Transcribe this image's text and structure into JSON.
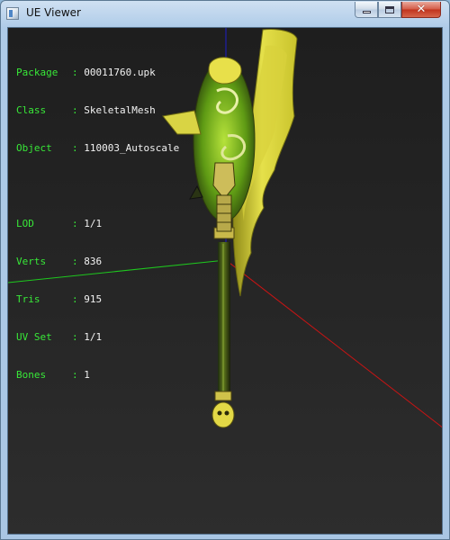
{
  "window": {
    "title": "UE Viewer",
    "controls": {
      "minimize": "minimize-icon",
      "maximize": "maximize-icon",
      "close": "close-icon"
    }
  },
  "info_block1": [
    {
      "label": "Package",
      "value": "00011760.upk"
    },
    {
      "label": "Class",
      "value": "SkeletalMesh"
    },
    {
      "label": "Object",
      "value": "110003_Autoscale"
    }
  ],
  "info_block2": [
    {
      "label": "LOD",
      "value": "1/1"
    },
    {
      "label": "Verts",
      "value": "836"
    },
    {
      "label": "Tris",
      "value": "915"
    },
    {
      "label": "UV Set",
      "value": "1/1"
    },
    {
      "label": "Bones",
      "value": "1"
    }
  ],
  "separator": ":",
  "colors": {
    "label_green": "#38e838",
    "value_white": "#f2f2f2",
    "axis_x": "#c81414",
    "axis_y": "#1ec81e",
    "axis_z": "#1e1ec8",
    "mesh_yellow": "#e5e04a",
    "mesh_green": "#7cc51e"
  }
}
